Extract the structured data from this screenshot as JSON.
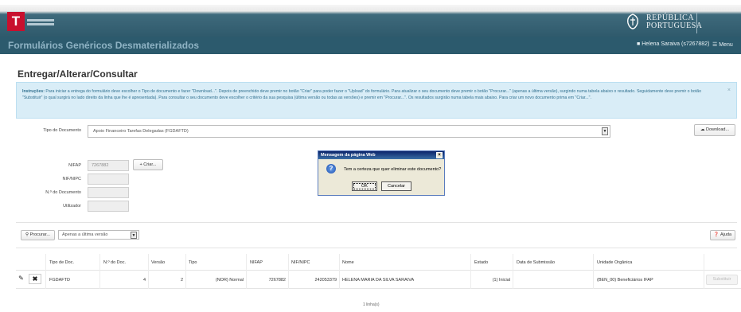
{
  "header": {
    "logo_letter": "T",
    "republic_line1": "REPÚBLICA",
    "republic_line2": "PORTUGUESA",
    "app_title": "Formulários Genéricos Desmaterializados",
    "user": "Helena Saraiva (s7267882)",
    "menu": "Menu"
  },
  "page": {
    "title": "Entregar/Alterar/Consultar",
    "info_label": "Instruções:",
    "info_text": " Para iniciar a entrega do formulário deve escolher o Tipo de documento e fazer \"Download...\". Depois de preenchido deve premir no botão \"Criar\" para poder fazer o \"Upload\" do formulário. Para atualizar o seu documento deve premir o botão \"Procurar...\" (apenas a última versão), surgindo numa tabela abaixo o resultado. Seguidamente deve premir o botão \"Substituir\" (o qual surgirá no lado direito da linha que lhe é apresentada). Para consultar o seu documento deve escolher o critério da sua pesquisa (última versão ou todas as versões) e premir em \"Procurar...\". Os resultados surgirão numa tabela mais abaixo. Para criar um novo documento prima em \"Criar...\".",
    "info_close": "×"
  },
  "form": {
    "tipo_label": "Tipo do Documento",
    "tipo_value": "Apoio Financeiro Tarefas Delegadas (FGDAFTD)",
    "download_label": "Download...",
    "nifap_label": "NIFAP",
    "nifap_value": "7267882",
    "criar_label": "Criar...",
    "nifnipc_label": "NIF/NIPC",
    "ndoc_label": "N.º do Documento",
    "utilizador_label": "Utilizador"
  },
  "dialog": {
    "title": "Mensagem da página Web",
    "message": "Tem a certeza que quer eliminar este documento?",
    "ok": "OK",
    "cancel": "Cancelar",
    "close": "×"
  },
  "search": {
    "procurar_label": "Procurar...",
    "versao_value": "Apenas a última versão",
    "ajuda_label": "Ajuda"
  },
  "table": {
    "headers": [
      "Tipo de Doc.",
      "N.º do Doc.",
      "Versão",
      "Tipo",
      "NIFAP",
      "NIF/NIPC",
      "Nome",
      "Estado",
      "Data de Submissão",
      "Unidade Orgânica"
    ],
    "row": {
      "tipo_doc": "FGDAFTD",
      "n_doc": "4",
      "versao": "2",
      "tipo": "(NOR) Normal",
      "nifap": "7267882",
      "nif_nipc": "242053379",
      "nome": "HELENA MARIA DA SILVA SARAIVA",
      "estado": "(1) Inicial",
      "data_submissao": "",
      "unidade": "(BEN_00) Beneficiários IFAP",
      "substituir": "Substituir"
    },
    "count": "1 linha(s)"
  }
}
